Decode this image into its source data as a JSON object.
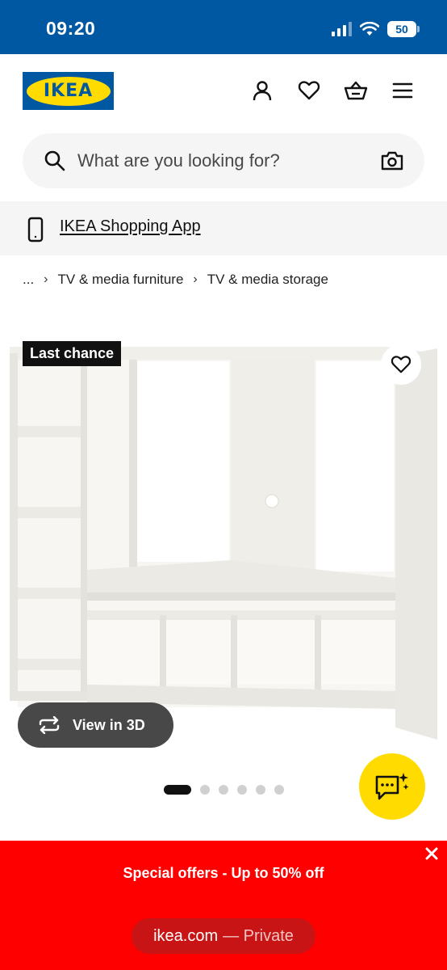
{
  "status_bar": {
    "time": "09:20",
    "battery": "50"
  },
  "header": {
    "logo_text": "IKEA",
    "icons": [
      "user-icon",
      "heart-icon",
      "basket-icon",
      "menu-icon"
    ]
  },
  "search": {
    "placeholder": "What are you looking for?"
  },
  "app_banner": {
    "label": "IKEA Shopping App"
  },
  "breadcrumb": {
    "ellipsis": "...",
    "items": [
      "TV & media furniture",
      "TV & media storage"
    ]
  },
  "product": {
    "badge": "Last chance",
    "view_3d_label": "View in 3D"
  },
  "carousel": {
    "count": 6,
    "active_index": 0
  },
  "offer_banner": {
    "text": "Special offers - Up to 50% off"
  },
  "browser_bar": {
    "domain": "ikea.com",
    "mode": "— Private"
  },
  "colors": {
    "ikea_blue": "#0058a3",
    "ikea_yellow": "#ffdb00",
    "offer_red": "#ff0000"
  }
}
